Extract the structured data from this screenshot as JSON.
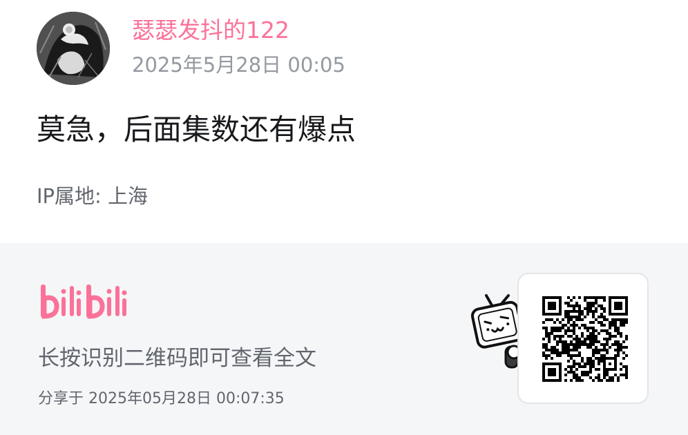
{
  "comment": {
    "username": "瑟瑟发抖的122",
    "post_time": "2025年5月28日 00:05",
    "text": "莫急，后面集数还有爆点",
    "ip_location": "IP属地: 上海"
  },
  "footer": {
    "hint": "长按识别二维码即可查看全文",
    "shared_at": "分享于 2025年05月28日 00:07:35",
    "logo_text": "bilibili"
  },
  "colors": {
    "brand_pink": "#fb7299",
    "footer_bg": "#f5f6f8",
    "text_primary": "#18191c",
    "text_secondary": "#9499a0"
  },
  "icons": {
    "avatar": "user-avatar",
    "logo": "bilibili-logo",
    "mascot": "tv-mascot-icon",
    "qr": "qr-code"
  }
}
